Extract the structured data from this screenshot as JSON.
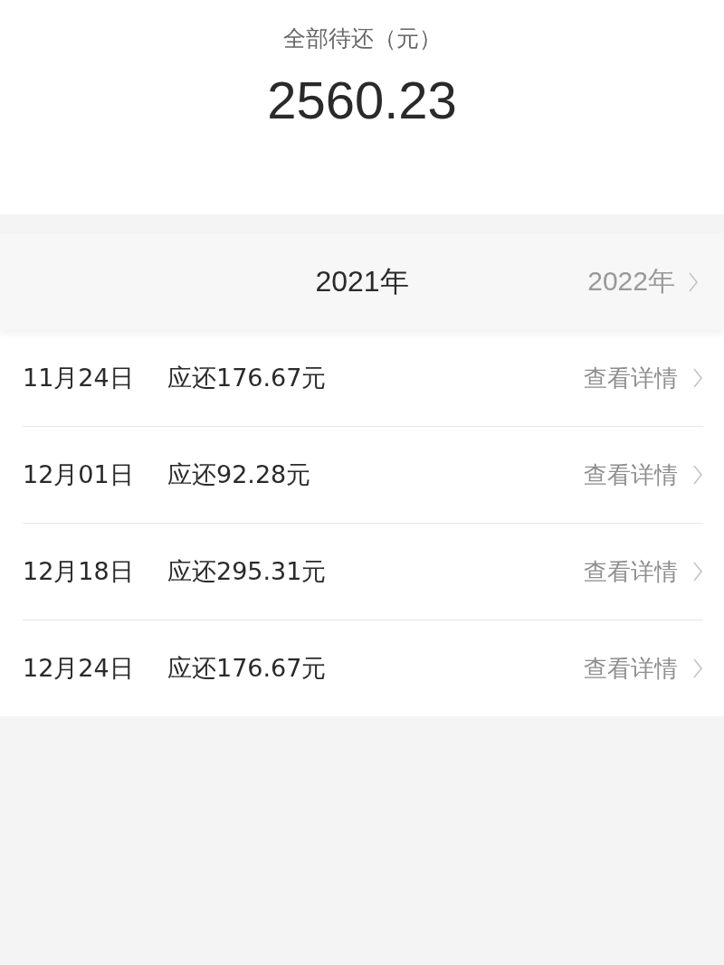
{
  "summary": {
    "label": "全部待还（元）",
    "amount": "2560.23"
  },
  "years": [
    {
      "label": "2021年",
      "selected": true
    },
    {
      "label": "2022年",
      "selected": false
    }
  ],
  "bills": [
    {
      "date": "11月24日",
      "due": "应还176.67元",
      "action": "查看详情"
    },
    {
      "date": "12月01日",
      "due": "应还92.28元",
      "action": "查看详情"
    },
    {
      "date": "12月18日",
      "due": "应还295.31元",
      "action": "查看详情"
    },
    {
      "date": "12月24日",
      "due": "应还176.67元",
      "action": "查看详情"
    }
  ]
}
